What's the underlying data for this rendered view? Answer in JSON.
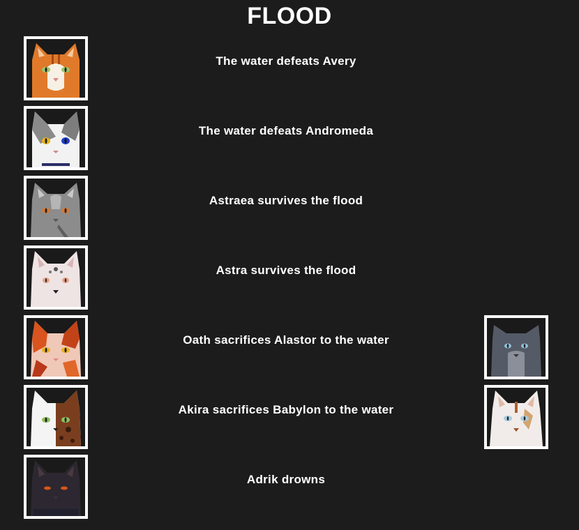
{
  "title": "FLOOD",
  "events": [
    {
      "text": "The water defeats Avery",
      "left_icon": "orange-tabby-cat-portrait",
      "right_icon": null
    },
    {
      "text": "The water defeats Andromeda",
      "left_icon": "gray-white-cat-portrait",
      "right_icon": null
    },
    {
      "text": "Astraea survives the flood",
      "left_icon": "gray-cat-portrait",
      "right_icon": null
    },
    {
      "text": "Astra survives the flood",
      "left_icon": "pale-cat-portrait",
      "right_icon": null
    },
    {
      "text": "Oath sacrifices Alastor to the water",
      "left_icon": "calico-cat-portrait",
      "right_icon": "dark-gray-cat-portrait"
    },
    {
      "text": "Akira sacrifices Babylon to the water",
      "left_icon": "white-brown-cat-portrait",
      "right_icon": "white-cat-portrait"
    },
    {
      "text": "Adrik drowns",
      "left_icon": "black-cat-portrait",
      "right_icon": null
    }
  ]
}
